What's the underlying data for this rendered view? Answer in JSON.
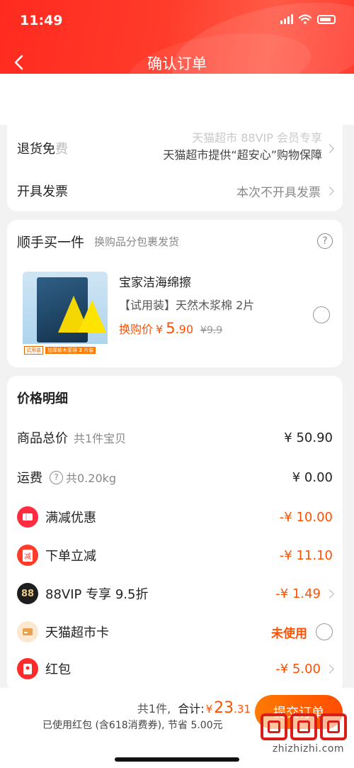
{
  "status_bar": {
    "time": "11:49"
  },
  "nav": {
    "title": "确认订单"
  },
  "service": {
    "return_label": "退货免",
    "return_label_tail": "费",
    "return_line1": "天猫超市 88VIP 会员专享",
    "return_line2": "天猫超市提供“超安心”购物保障",
    "invoice_label": "开具发票",
    "invoice_value": "本次不开具发票"
  },
  "addon": {
    "title": "顺手买一件",
    "subtitle": "换购品分包裹发货",
    "product_name": "宝家洁海绵擦",
    "product_desc": "【试用装】天然木浆棉 2片",
    "price_label": "换购价",
    "price_symbol": "¥",
    "price_int": "5",
    "price_dec": ".90",
    "orig_price": "¥9.9",
    "img_tag1": "试用装",
    "img_tag2": "加厚款木浆棉",
    "img_tag3": "2",
    "img_tag4": "片装"
  },
  "price": {
    "title": "价格明细",
    "rows": [
      {
        "label": "商品总价",
        "sub": "共1件宝贝",
        "value": "¥ 50.90"
      },
      {
        "label": "运费",
        "sub": "共0.20kg",
        "value": "¥ 0.00"
      },
      {
        "label": "满减优惠",
        "value": "-¥ 10.00"
      },
      {
        "label": "下单立减",
        "value": "-¥ 11.10"
      },
      {
        "label": "88VIP 专享 9.5折",
        "value": "-¥ 1.49"
      },
      {
        "label": "天猫超市卡",
        "value": "未使用"
      },
      {
        "label": "红包",
        "value": "-¥ 5.00"
      }
    ],
    "vip_badge": "88",
    "reduce_badge": "减"
  },
  "footer": {
    "count": "共1件,",
    "total_label": "合计:",
    "total_symbol": "¥",
    "total_int": "23",
    "total_dec": ".31",
    "saving": "已使用红包 (含618消费券), 节省 5.00元",
    "submit": "提交订单",
    "watermark": "zhizhizhi.com"
  },
  "colors": {
    "brand_red": "#ff2a1f",
    "accent_orange": "#ff5000"
  }
}
